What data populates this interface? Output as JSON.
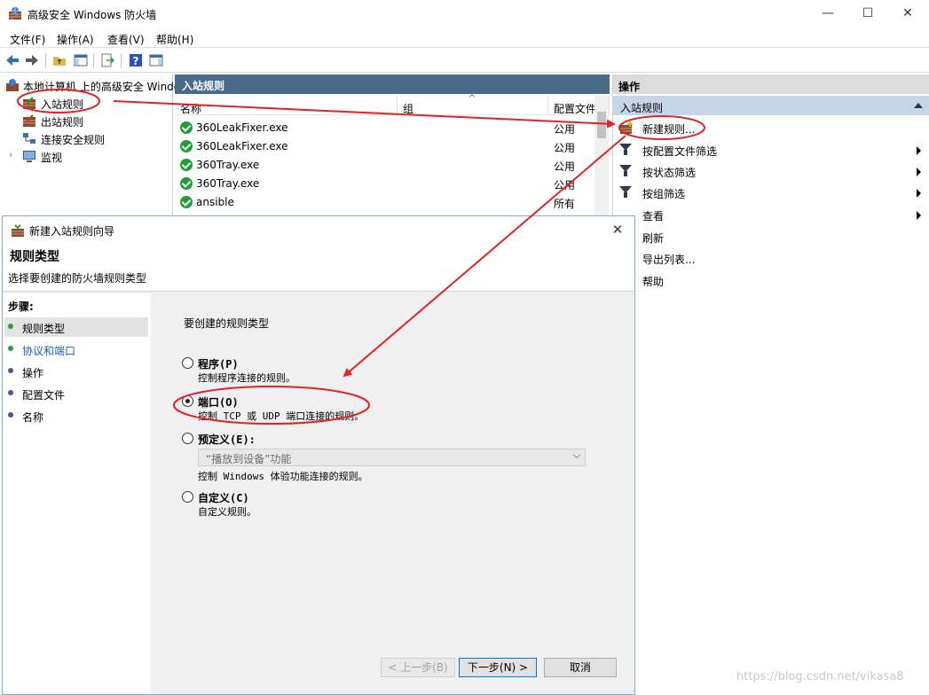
{
  "window": {
    "title": "高级安全 Windows 防火墙",
    "min": "—",
    "max": "☐",
    "close": "✕"
  },
  "menu": [
    "文件(F)",
    "操作(A)",
    "查看(V)",
    "帮助(H)"
  ],
  "tree": {
    "root": "本地计算机 上的高级安全 Windows",
    "items": [
      "入站规则",
      "出站规则",
      "连接安全规则",
      "监视"
    ]
  },
  "center": {
    "header": "入站规则",
    "columns": [
      "名称",
      "组",
      "配置文件"
    ],
    "rows": [
      {
        "name": "360LeakFixer.exe",
        "profile": "公用"
      },
      {
        "name": "360LeakFixer.exe",
        "profile": "公用"
      },
      {
        "name": "360Tray.exe",
        "profile": "公用"
      },
      {
        "name": "360Tray.exe",
        "profile": "公用"
      },
      {
        "name": "ansible",
        "profile": "所有"
      }
    ]
  },
  "actions": {
    "header": "操作",
    "section": "入站规则",
    "items": [
      "新建规则...",
      "按配置文件筛选",
      "按状态筛选",
      "按组筛选",
      "查看",
      "刷新",
      "导出列表...",
      "帮助"
    ]
  },
  "dialog": {
    "title": "新建入站规则向导",
    "close": "✕",
    "heading": "规则类型",
    "subheading": "选择要创建的防火墙规则类型",
    "steps_label": "步骤:",
    "steps": [
      "规则类型",
      "协议和端口",
      "操作",
      "配置文件",
      "名称"
    ],
    "prompt": "要创建的规则类型",
    "options": [
      {
        "label": "程序(P)",
        "desc": "控制程序连接的规则。"
      },
      {
        "label": "端口(O)",
        "desc": "控制 TCP 或 UDP 端口连接的规则。"
      },
      {
        "label": "预定义(E):",
        "desc": ""
      },
      {
        "label": "自定义(C)",
        "desc": "自定义规则。"
      }
    ],
    "selected_option": "端口(O)",
    "predefined_select": "“播放到设备”功能",
    "predefined_desc": "控制 Windows 体验功能连接的规则。",
    "buttons": {
      "back": "< 上一步(B)",
      "next": "下一步(N) >",
      "cancel": "取消"
    }
  },
  "watermark": "https://blog.csdn.net/vikasa8",
  "colors": {
    "accent_blue": "#4a6b8a",
    "annotation_red": "#e02424",
    "check_green": "#1e9e3a"
  }
}
